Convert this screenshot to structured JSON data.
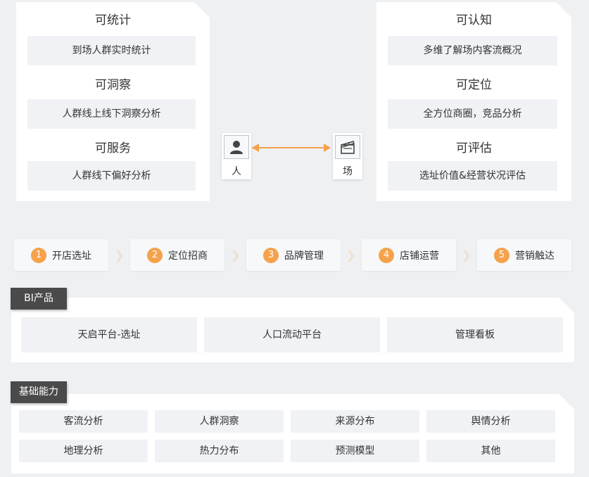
{
  "left_panel": {
    "groups": [
      {
        "title": "可统计",
        "item": "到场人群实时统计"
      },
      {
        "title": "可洞察",
        "item": "人群线上线下洞察分析"
      },
      {
        "title": "可服务",
        "item": "人群线下偏好分析"
      }
    ]
  },
  "right_panel": {
    "groups": [
      {
        "title": "可认知",
        "item": "多维了解场内客流概况"
      },
      {
        "title": "可定位",
        "item": "全方位商圈，竞品分析"
      },
      {
        "title": "可评估",
        "item": "选址价值&经营状况评估"
      }
    ]
  },
  "connector": {
    "person_label": "人",
    "place_label": "场",
    "person_icon": "person-icon",
    "place_icon": "clapperboard-icon",
    "arrow_color": "#f5a24b"
  },
  "steps": [
    {
      "num": "1",
      "label": "开店选址"
    },
    {
      "num": "2",
      "label": "定位招商"
    },
    {
      "num": "3",
      "label": "品牌管理"
    },
    {
      "num": "4",
      "label": "店铺运营"
    },
    {
      "num": "5",
      "label": "营销触达"
    }
  ],
  "bi_section": {
    "tab": "BI产品",
    "items": [
      "天启平台-选址",
      "人口流动平台",
      "管理看板"
    ]
  },
  "base_section": {
    "tab": "基础能力",
    "items": [
      "客流分析",
      "人群洞察",
      "来源分布",
      "舆情分析",
      "地理分析",
      "热力分布",
      "预测模型",
      "其他"
    ]
  },
  "colors": {
    "accent": "#f5a24b",
    "tab_bg": "#4a4a4a",
    "box_bg": "#f0f2f5",
    "page_bg": "#eef0f2"
  }
}
